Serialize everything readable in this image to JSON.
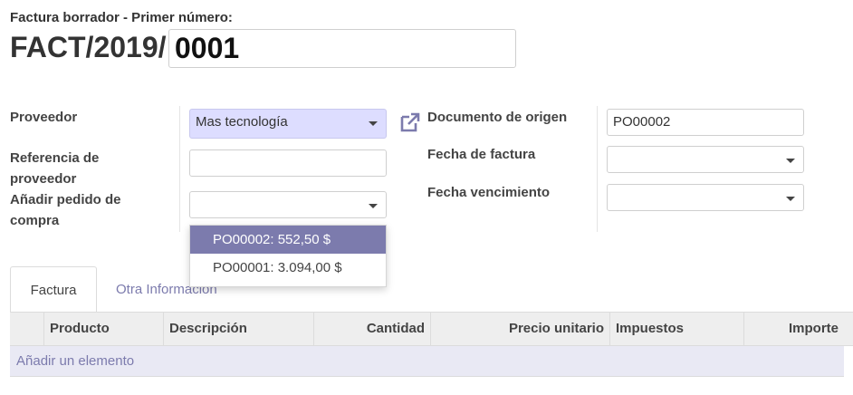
{
  "header": {
    "subtitle": "Factura borrador  - Primer número:",
    "prefix": "FACT/2019/",
    "number": "0001"
  },
  "form": {
    "proveedor_label": "Proveedor",
    "proveedor_value": "Mas tecnología",
    "referencia_label": "Referencia de proveedor",
    "referencia_value": "",
    "pedido_label": "Añadir pedido de compra",
    "pedido_value": "",
    "documento_label": "Documento de origen",
    "documento_value": "PO00002",
    "fecha_factura_label": "Fecha de factura",
    "fecha_factura_value": "",
    "fecha_venc_label": "Fecha vencimiento",
    "fecha_venc_value": ""
  },
  "dropdown": {
    "options": [
      "PO00002: 552,50 $",
      "PO00001: 3.094,00 $"
    ],
    "active_index": 0
  },
  "tabs": {
    "factura": "Factura",
    "otra": "Otra Información"
  },
  "table": {
    "columns": [
      "Producto",
      "Descripción",
      "Cantidad",
      "Precio unitario",
      "Impuestos",
      "Importe"
    ],
    "add_line": "Añadir un elemento"
  },
  "colors": {
    "accent": "#7c7bad",
    "selected_field": "#ddddff"
  },
  "icons": {
    "external": "external-link-icon",
    "caret": "caret-down-icon"
  }
}
